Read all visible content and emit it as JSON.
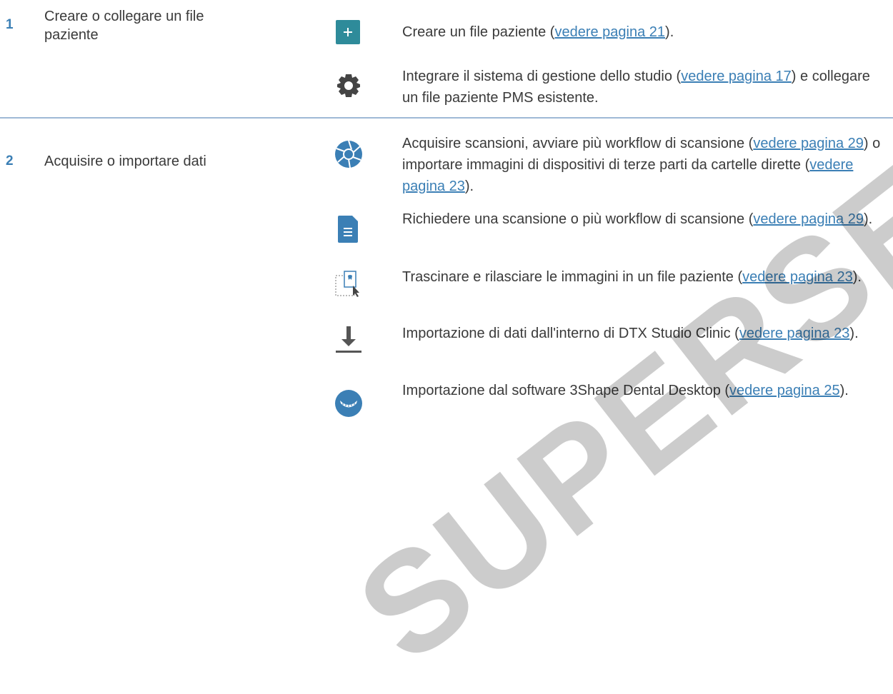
{
  "steps": [
    {
      "number": "1",
      "label": "Creare o collegare un file paziente",
      "actions": [
        {
          "icon": "plus-icon",
          "parts": [
            {
              "text": "Creare un file paziente ("
            },
            {
              "text": "vedere pagina 21",
              "link": true
            },
            {
              "text": ")."
            }
          ]
        },
        {
          "icon": "gear-icon",
          "parts": [
            {
              "text": "Integrare il sistema di gestione dello studio ("
            },
            {
              "text": "vedere pagina 17",
              "link": true
            },
            {
              "text": ") e collegare un file paziente PMS esistente."
            }
          ]
        }
      ]
    },
    {
      "number": "2",
      "label": "Acquisire o importare dati",
      "actions": [
        {
          "icon": "camera-aperture-icon",
          "parts": [
            {
              "text": "Acquisire scansioni, avviare più workflow di scansione ("
            },
            {
              "text": "vedere pagina 29",
              "link": true
            },
            {
              "text": ") o importare immagini di dispositivi di terze parti da cartelle dirette ("
            },
            {
              "text": "vedere pagina 23",
              "link": true
            },
            {
              "text": ")."
            }
          ]
        },
        {
          "icon": "document-icon",
          "parts": [
            {
              "text": "Richiedere una scansione o più workflow di scansione ("
            },
            {
              "text": "vedere pagina 29",
              "link": true
            },
            {
              "text": ")."
            }
          ]
        },
        {
          "icon": "drag-drop-icon",
          "parts": [
            {
              "text": "Trascinare e rilasciare le immagini in un file paziente ("
            },
            {
              "text": "vedere pagina 23",
              "link": true
            },
            {
              "text": ")."
            }
          ]
        },
        {
          "icon": "download-icon",
          "parts": [
            {
              "text": "Importazione di dati dall'interno di DTX Studio Clinic ("
            },
            {
              "text": "vedere pagina 23",
              "link": true
            },
            {
              "text": ")."
            }
          ]
        },
        {
          "icon": "3shape-icon",
          "parts": [
            {
              "text": "Importazione dal software 3Shape Dental Desktop ("
            },
            {
              "text": "vedere pagina 25",
              "link": true
            },
            {
              "text": ")."
            }
          ]
        }
      ]
    }
  ],
  "watermark": "SUPERSEDED",
  "colors": {
    "accent": "#3b7fb5",
    "teal": "#2e8b9a",
    "icon_gray": "#444444",
    "divider": "#9fb9d6"
  }
}
